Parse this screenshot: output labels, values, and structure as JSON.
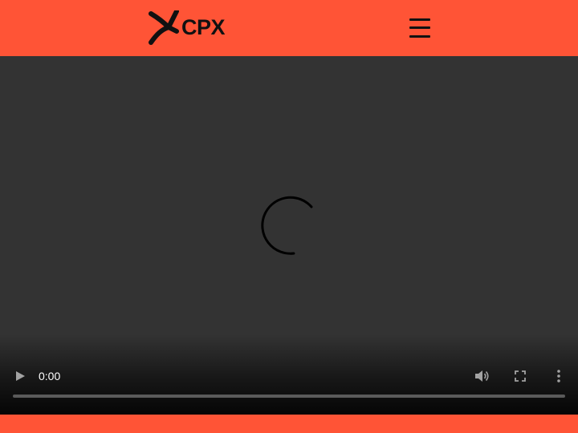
{
  "brand": {
    "name": "CPX",
    "accent_color": "#ff5436",
    "text_color": "#111111"
  },
  "header": {
    "menu_icon": "hamburger-menu-icon"
  },
  "video_player": {
    "background_color": "#333333",
    "state": "loading",
    "spinner_icon": "loading-spinner-icon",
    "current_time": "0:00",
    "progress": 0,
    "controls": {
      "play_icon": "play-icon",
      "volume_icon": "volume-icon",
      "fullscreen_icon": "fullscreen-icon",
      "more_icon": "more-options-icon"
    }
  }
}
